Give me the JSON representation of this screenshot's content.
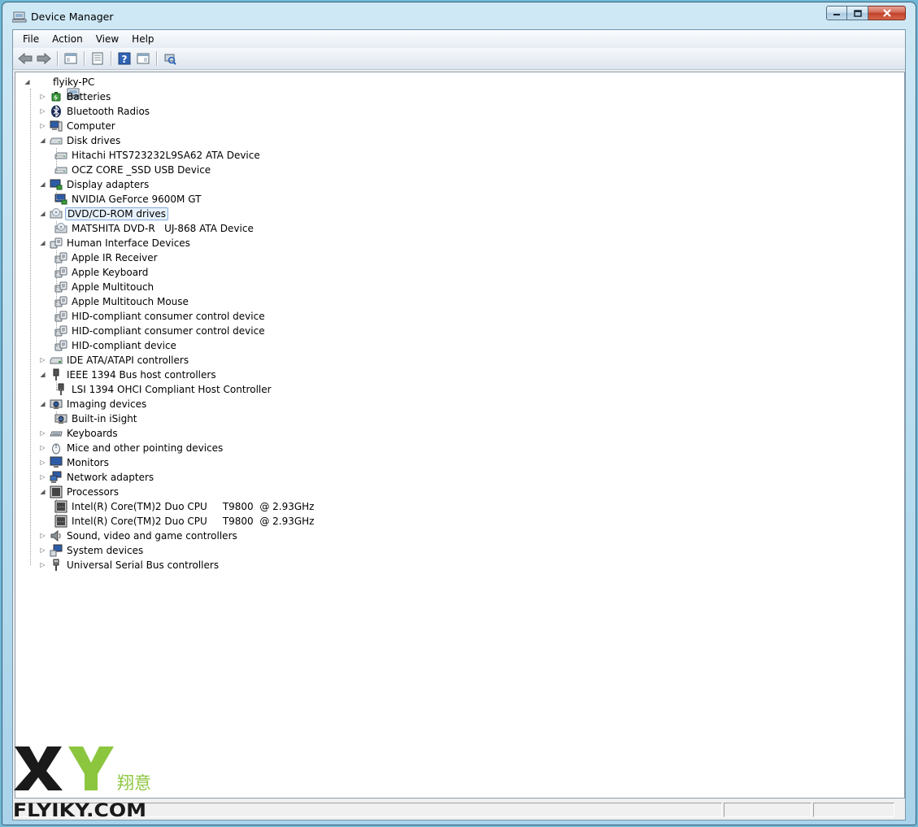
{
  "window": {
    "title": "Device Manager"
  },
  "menu": [
    "File",
    "Action",
    "View",
    "Help"
  ],
  "toolbar": {
    "buttons": [
      "back-icon",
      "forward-icon",
      "show-hide-tree-icon",
      "properties-icon",
      "help-icon",
      "view-icon",
      "scan-hardware-icon"
    ]
  },
  "tree": {
    "root": "flyiky-PC",
    "items": [
      {
        "label": "Batteries",
        "level": 1,
        "expanded": false,
        "icon": "battery-icon"
      },
      {
        "label": "Bluetooth Radios",
        "level": 1,
        "expanded": false,
        "icon": "bluetooth-icon"
      },
      {
        "label": "Computer",
        "level": 1,
        "expanded": false,
        "icon": "computer-icon"
      },
      {
        "label": "Disk drives",
        "level": 1,
        "expanded": true,
        "icon": "disk-drive-icon"
      },
      {
        "label": "Hitachi HTS723232L9SA62 ATA Device",
        "level": 2,
        "icon": "disk-drive-icon"
      },
      {
        "label": "OCZ CORE _SSD USB Device",
        "level": 2,
        "icon": "disk-drive-icon"
      },
      {
        "label": "Display adapters",
        "level": 1,
        "expanded": true,
        "icon": "display-adapter-icon"
      },
      {
        "label": "NVIDIA GeForce 9600M GT",
        "level": 2,
        "icon": "display-adapter-icon"
      },
      {
        "label": "DVD/CD-ROM drives",
        "level": 1,
        "expanded": true,
        "icon": "dvd-drive-icon",
        "selected": true
      },
      {
        "label": "MATSHITA DVD-R   UJ-868 ATA Device",
        "level": 2,
        "icon": "dvd-drive-icon"
      },
      {
        "label": "Human Interface Devices",
        "level": 1,
        "expanded": true,
        "icon": "hid-icon"
      },
      {
        "label": "Apple IR Receiver",
        "level": 2,
        "icon": "hid-icon"
      },
      {
        "label": "Apple Keyboard",
        "level": 2,
        "icon": "hid-icon"
      },
      {
        "label": "Apple Multitouch",
        "level": 2,
        "icon": "hid-icon"
      },
      {
        "label": "Apple Multitouch Mouse",
        "level": 2,
        "icon": "hid-icon"
      },
      {
        "label": "HID-compliant consumer control device",
        "level": 2,
        "icon": "hid-icon"
      },
      {
        "label": "HID-compliant consumer control device",
        "level": 2,
        "icon": "hid-icon"
      },
      {
        "label": "HID-compliant device",
        "level": 2,
        "icon": "hid-icon"
      },
      {
        "label": "IDE ATA/ATAPI controllers",
        "level": 1,
        "expanded": false,
        "icon": "ide-controller-icon"
      },
      {
        "label": "IEEE 1394 Bus host controllers",
        "level": 1,
        "expanded": true,
        "icon": "firewire-icon"
      },
      {
        "label": "LSI 1394 OHCI Compliant Host Controller",
        "level": 2,
        "icon": "firewire-icon"
      },
      {
        "label": "Imaging devices",
        "level": 1,
        "expanded": true,
        "icon": "camera-icon"
      },
      {
        "label": "Built-in iSight",
        "level": 2,
        "icon": "camera-icon"
      },
      {
        "label": "Keyboards",
        "level": 1,
        "expanded": false,
        "icon": "keyboard-icon"
      },
      {
        "label": "Mice and other pointing devices",
        "level": 1,
        "expanded": false,
        "icon": "mouse-icon"
      },
      {
        "label": "Monitors",
        "level": 1,
        "expanded": false,
        "icon": "monitor-icon"
      },
      {
        "label": "Network adapters",
        "level": 1,
        "expanded": false,
        "icon": "network-adapter-icon"
      },
      {
        "label": "Processors",
        "level": 1,
        "expanded": true,
        "icon": "processor-icon"
      },
      {
        "label": "Intel(R) Core(TM)2 Duo CPU     T9800  @ 2.93GHz",
        "level": 2,
        "icon": "processor-icon"
      },
      {
        "label": "Intel(R) Core(TM)2 Duo CPU     T9800  @ 2.93GHz",
        "level": 2,
        "icon": "processor-icon"
      },
      {
        "label": "Sound, video and game controllers",
        "level": 1,
        "expanded": false,
        "icon": "speaker-icon"
      },
      {
        "label": "System devices",
        "level": 1,
        "expanded": false,
        "icon": "system-devices-icon"
      },
      {
        "label": "Universal Serial Bus controllers",
        "level": 1,
        "expanded": false,
        "icon": "usb-icon"
      }
    ]
  },
  "watermark": {
    "letters": "XY",
    "chinese": "翔意",
    "site": "FLYIKY.COM"
  },
  "colors": {
    "selection": "#e6f1fc",
    "selection_border": "#84acdd",
    "watermark_green": "#8cc63f"
  }
}
